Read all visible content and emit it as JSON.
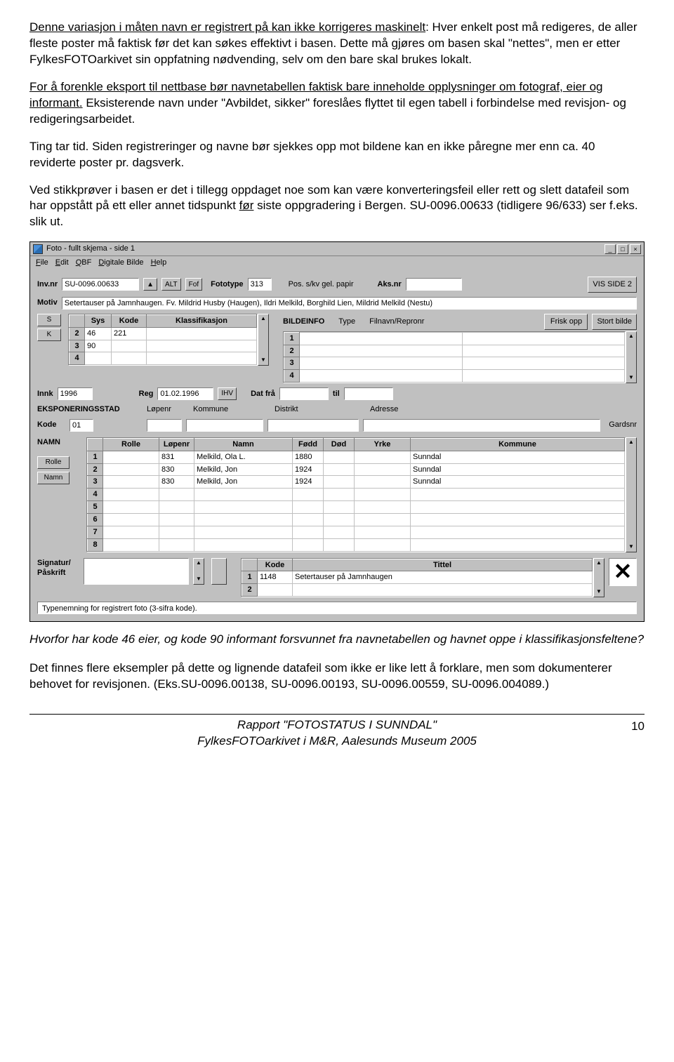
{
  "para1_a": "Denne variasjon i måten navn er registrert på kan ikke korrigeres maskinelt",
  "para1_b": ": Hver enkelt post må redigeres, de aller fleste poster må faktisk før det kan søkes effektivt i basen. Dette må gjøres om basen skal \"nettes\", men er etter FylkesFOTOarkivet sin oppfatning nødvending, selv om den bare skal brukes lokalt.",
  "para2_a": "For å forenkle eksport til nettbase bør navnetabellen faktisk bare inneholde opplysninger om fotograf, eier og informant.",
  "para2_b": " Eksisterende navn under \"Avbildet, sikker\" foreslåes flyttet til egen tabell i forbindelse med revisjon- og redigeringsarbeidet.",
  "para3": "Ting tar tid. Siden registreringer og navne bør sjekkes opp mot bildene kan en ikke påregne mer enn ca. 40 reviderte poster pr. dagsverk.",
  "para4_a": "Ved stikkprøver i basen er det i tillegg oppdaget noe som kan være konverteringsfeil eller rett og slett datafeil som har oppstått på ett eller annet tidspunkt ",
  "para4_b": "før",
  "para4_c": " siste oppgradering i Bergen. SU-0096.00633 (tidligere 96/633) ser f.eks. slik ut.",
  "caption": "Hvorfor har kode 46 eier, og kode 90 informant forsvunnet fra navnetabellen og havnet oppe i klassifikasjonsfeltene?",
  "para5": "Det finnes flere eksempler på dette og lignende datafeil som ikke er like lett å forklare, men som dokumenterer behovet for revisjonen.  (Eks.SU-0096.00138, SU-0096.00193, SU-0096.00559, SU-0096.004089.)",
  "footer1": "Rapport \"FOTOSTATUS I SUNNDAL\"",
  "footer2": "FylkesFOTOarkivet i M&R, Aalesunds Museum 2005",
  "pagenum": "10",
  "app": {
    "title": "Foto - fullt skjema - side 1",
    "menu": [
      "File",
      "Edit",
      "QBF",
      "Digitale Bilde",
      "Help"
    ],
    "labels": {
      "invnr": "Inv.nr",
      "alt": "ALT",
      "fof": "Fof",
      "fototype": "Fototype",
      "posskv": "Pos. s/kv gel. papir",
      "aksnr": "Aks.nr",
      "visside2": "VIS SIDE 2",
      "motiv": "Motiv",
      "s": "S",
      "k": "K",
      "sys": "Sys",
      "kode": "Kode",
      "klass": "Klassifikasjon",
      "bildeinfo": "BILDEINFO",
      "type": "Type",
      "filnavn": "Filnavn/Repronr",
      "friskopp": "Frisk opp",
      "stortbilde": "Stort bilde",
      "innk": "Innk",
      "reg": "Reg",
      "ihv": "IHV",
      "datfra": "Dat frå",
      "til": "til",
      "eksp": "EKSPONERINGSSTAD",
      "lopenr": "Løpenr",
      "kommune": "Kommune",
      "distrikt": "Distrikt",
      "adresse": "Adresse",
      "gardsnr": "Gardsnr",
      "navn": "NAMN",
      "rolle": "Rolle",
      "namn": "Namn",
      "fodd": "Fødd",
      "dod": "Død",
      "yrke": "Yrke",
      "signatur": "Signatur/\nPåskrift",
      "tittel": "Tittel",
      "arrowup": "▲",
      "arrowdn": "▼"
    },
    "values": {
      "invnr": "SU-0096.00633",
      "fototype": "313",
      "motiv": "Setertauser på Jamnhaugen. Fv. Mildrid Husby (Haugen), Ildri Melkild, Borghild Lien, Mildrid Melkild (Nestu)",
      "klass": [
        {
          "n": "2",
          "sys": "46",
          "kode": "221"
        },
        {
          "n": "3",
          "sys": "90",
          "kode": ""
        },
        {
          "n": "4",
          "sys": "",
          "kode": ""
        }
      ],
      "bildeinfo_rows": [
        "1",
        "2",
        "3",
        "4"
      ],
      "innk": "1996",
      "reg": "01.02.1996",
      "kode01": "01",
      "namn_rows": [
        {
          "n": "1",
          "lp": "831",
          "namn": "Melkild, Ola L.",
          "fodd": "1880",
          "dod": "",
          "yrke": "",
          "kom": "Sunndal"
        },
        {
          "n": "2",
          "lp": "830",
          "namn": "Melkild, Jon",
          "fodd": "1924",
          "dod": "",
          "yrke": "",
          "kom": "Sunndal"
        },
        {
          "n": "3",
          "lp": "830",
          "namn": "Melkild, Jon",
          "fodd": "1924",
          "dod": "",
          "yrke": "",
          "kom": "Sunndal"
        },
        {
          "n": "4",
          "lp": "",
          "namn": "",
          "fodd": "",
          "dod": "",
          "yrke": "",
          "kom": ""
        },
        {
          "n": "5",
          "lp": "",
          "namn": "",
          "fodd": "",
          "dod": "",
          "yrke": "",
          "kom": ""
        },
        {
          "n": "6",
          "lp": "",
          "namn": "",
          "fodd": "",
          "dod": "",
          "yrke": "",
          "kom": ""
        },
        {
          "n": "7",
          "lp": "",
          "namn": "",
          "fodd": "",
          "dod": "",
          "yrke": "",
          "kom": ""
        },
        {
          "n": "8",
          "lp": "",
          "namn": "",
          "fodd": "",
          "dod": "",
          "yrke": "",
          "kom": ""
        }
      ],
      "tittel_rows": [
        {
          "n": "1",
          "kode": "1148",
          "tittel": "Setertauser på Jamnhaugen"
        },
        {
          "n": "2",
          "kode": "",
          "tittel": ""
        }
      ],
      "status": "Typenemning for registrert foto (3-sifra kode)."
    }
  }
}
